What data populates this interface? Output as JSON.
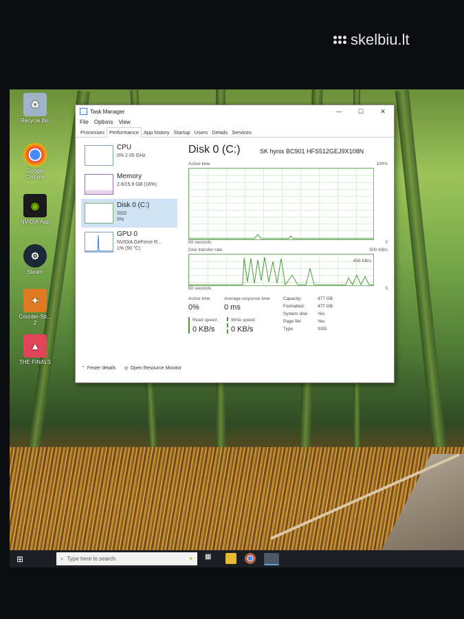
{
  "watermark": {
    "text": "skelbiu.lt"
  },
  "desktop_icons": [
    {
      "label": "Recycle Bin",
      "icon": "recycle-bin-icon",
      "color": "#9fb4c8"
    },
    {
      "label": "Google Chrome",
      "icon": "chrome-icon",
      "color": "#e8453c"
    },
    {
      "label": "NVIDIA App",
      "icon": "nvidia-icon",
      "color": "#76b900"
    },
    {
      "label": "Steam",
      "icon": "steam-icon",
      "color": "#1b2838"
    },
    {
      "label": "Counter-Str... 2",
      "icon": "counter-strike-icon",
      "color": "#e07a21"
    },
    {
      "label": "THE FINALS",
      "icon": "the-finals-icon",
      "color": "#e0455a"
    }
  ],
  "taskbar": {
    "search_placeholder": "Type here to search"
  },
  "task_manager": {
    "title": "Task Manager",
    "menu": [
      "File",
      "Options",
      "View"
    ],
    "tabs": [
      "Processes",
      "Performance",
      "App history",
      "Startup",
      "Users",
      "Details",
      "Services"
    ],
    "active_tab": "Performance",
    "side": [
      {
        "title": "CPU",
        "sub1": "0% 2.05 GHz",
        "sub2": ""
      },
      {
        "title": "Memory",
        "sub1": "2.6/15.9 GB (16%)",
        "sub2": ""
      },
      {
        "title": "Disk 0 (C:)",
        "sub1": "SSD",
        "sub2": "0%"
      },
      {
        "title": "GPU 0",
        "sub1": "NVIDIA GeForce R...",
        "sub2": "1% (50 °C)"
      }
    ],
    "selected_index": 2,
    "disk": {
      "title": "Disk 0 (C:)",
      "model": "SK hynix BC901 HFS512GEJ9X108N",
      "active_time_label": "Active time",
      "active_time_max": "100%",
      "seconds_label": "60 seconds",
      "zero_label": "0",
      "transfer_label": "Disk transfer rate",
      "transfer_max": "500 KB/s",
      "transfer_mid": "450 KB/s",
      "stats": {
        "active_time_label": "Active time",
        "active_time_value": "0%",
        "response_label": "Average response time",
        "response_value": "0 ms",
        "read_label": "Read speed",
        "read_value": "0 KB/s",
        "write_label": "Write speed",
        "write_value": "0 KB/s"
      },
      "specs": [
        {
          "label": "Capacity:",
          "value": "477 GB"
        },
        {
          "label": "Formatted:",
          "value": "477 GB"
        },
        {
          "label": "System disk:",
          "value": "Yes"
        },
        {
          "label": "Page file:",
          "value": "Yes"
        },
        {
          "label": "Type:",
          "value": "SSD"
        }
      ]
    },
    "footer": {
      "fewer": "Fewer details",
      "monitor": "Open Resource Monitor"
    }
  }
}
